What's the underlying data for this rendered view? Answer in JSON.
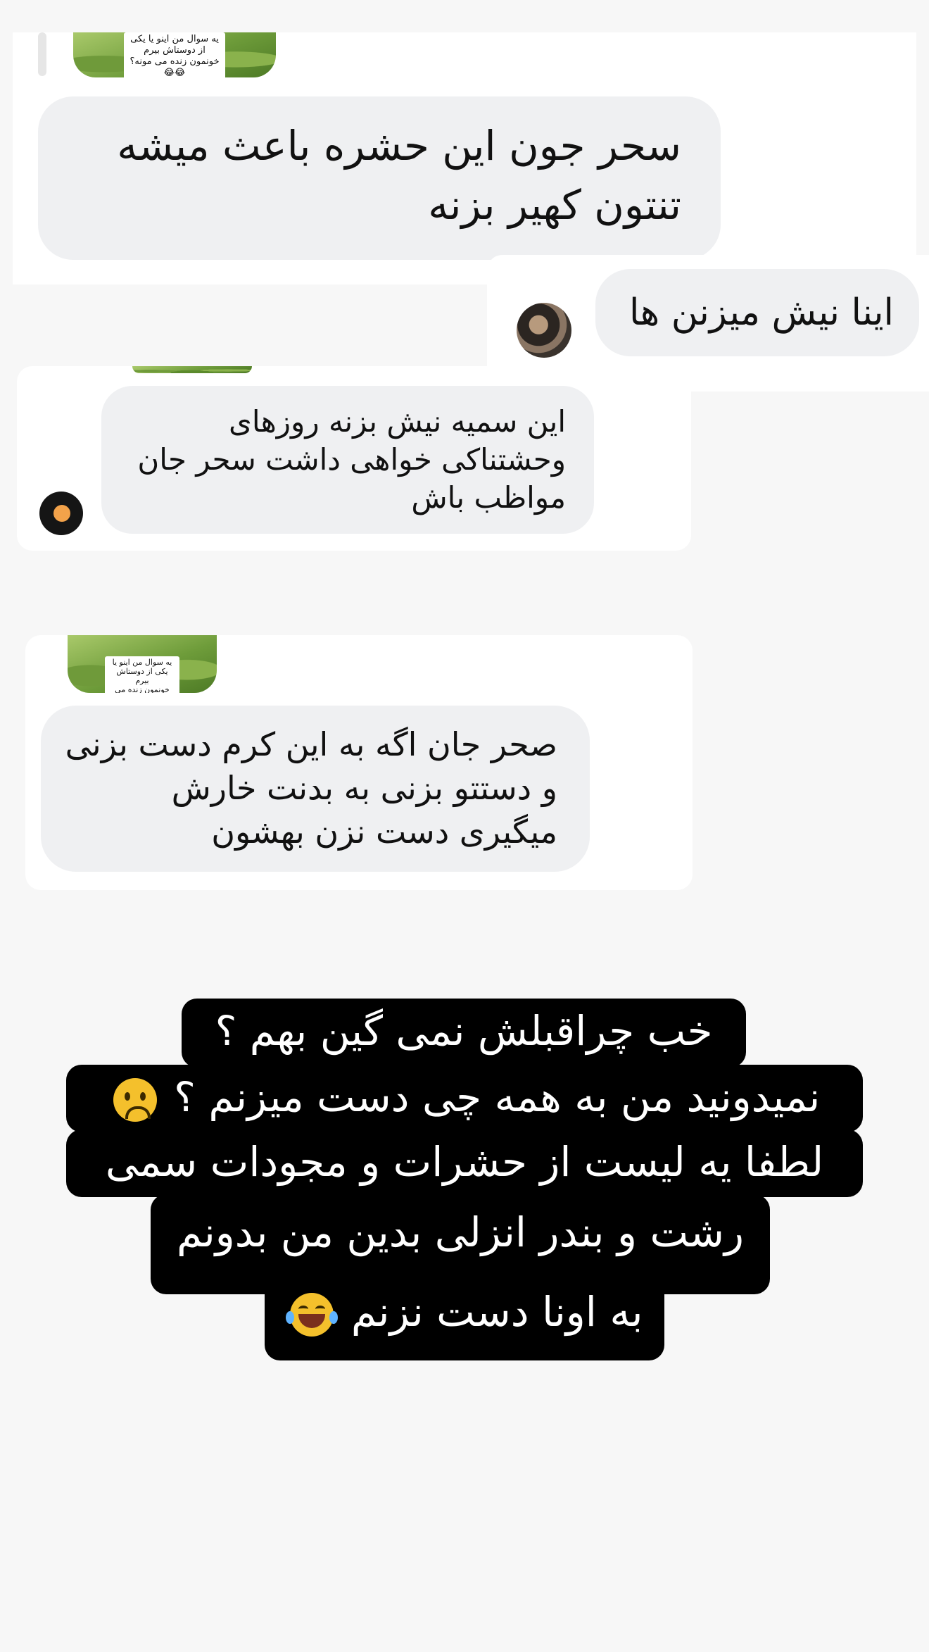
{
  "thumbnails": {
    "caption": "یه سوال من اینو یا یکی از دوستاش بیرم\nخونمون زنده می مونه؟😂😂"
  },
  "comments": [
    {
      "text": "سحر جون این حشره باعث میشه\nتنتون کهیر بزنه"
    },
    {
      "text": "اینا نیش میزنن ها"
    },
    {
      "text": "این سمیه نیش بزنه روزهای\nوحشتناکی خواهی داشت سحر جان\nمواظب باش"
    },
    {
      "text": "صحر جان اگه به این کرم دست بزنی\nو دستتو بزنی به بدنت خارش\nمیگیری دست نزن بهشون"
    }
  ],
  "story_caption": {
    "lines": [
      "خب چراقبلش نمی گین بهم ؟",
      "نمیدونید من به همه چی دست میزنم ؟",
      "لطفا یه لیست از حشرات و مجودات سمی",
      "رشت و بندر انزلی بدین من بدونم",
      "به اونا دست نزنم"
    ],
    "emojis": [
      "frowning-face",
      "tears-of-joy-face"
    ]
  },
  "colors": {
    "bubble": "#eff0f2",
    "card": "#ffffff",
    "caption_bg": "#000000",
    "caption_text": "#ffffff"
  }
}
